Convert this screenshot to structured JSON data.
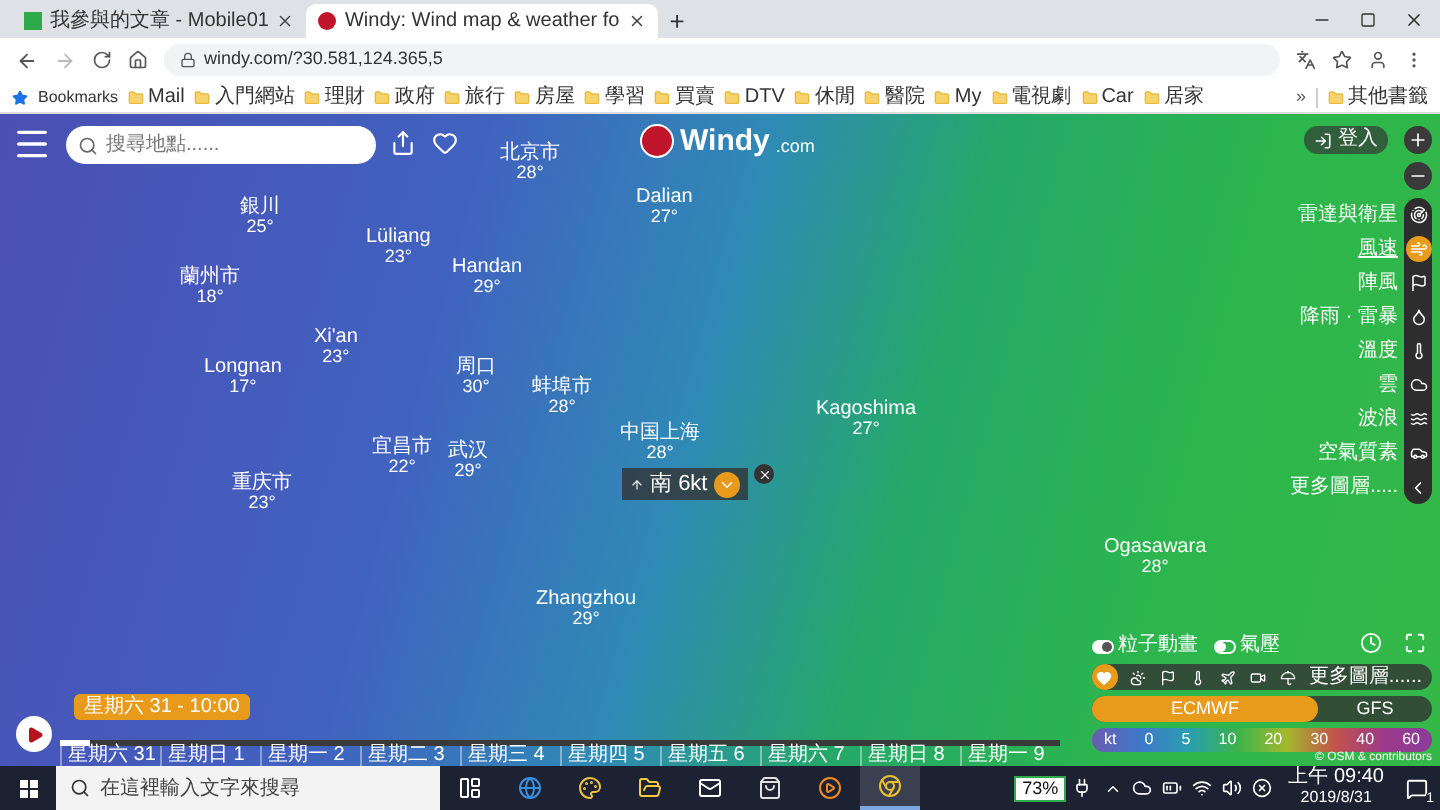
{
  "browser": {
    "tabs": [
      {
        "title": "我參與的文章 - Mobile01",
        "selected": false
      },
      {
        "title": "Windy: Wind map & weather fo",
        "selected": true
      }
    ],
    "new_tab": "+",
    "url": "windy.com/?30.581,124.365,5",
    "bookmarks_label": "Bookmarks",
    "bookmarks": [
      "Mail",
      "入門網站",
      "理財",
      "政府",
      "旅行",
      "房屋",
      "學習",
      "買賣",
      "DTV",
      "休閒",
      "醫院",
      "My",
      "電視劇",
      "Car",
      "居家"
    ],
    "more_bookmarks": "»",
    "other_bookmarks": "其他書籤"
  },
  "map": {
    "search": {
      "placeholder": "搜尋地點......"
    },
    "logo": {
      "name": "Windy",
      "suffix": ".com"
    },
    "login": "登入",
    "labels": [
      {
        "name": "北京市",
        "temp": "28°"
      },
      {
        "name": "銀川",
        "temp": "25°"
      },
      {
        "name": "Lüliang",
        "temp": "23°"
      },
      {
        "name": "Handan",
        "temp": "29°"
      },
      {
        "name": "Dalian",
        "temp": "27°"
      },
      {
        "name": "蘭州市",
        "temp": "18°"
      },
      {
        "name": "Xi'an",
        "temp": "23°"
      },
      {
        "name": "Longnan",
        "temp": "17°"
      },
      {
        "name": "周口",
        "temp": "30°"
      },
      {
        "name": "蚌埠市",
        "temp": "28°"
      },
      {
        "name": "宜昌市",
        "temp": "22°"
      },
      {
        "name": "武汉",
        "temp": "29°"
      },
      {
        "name": "重庆市",
        "temp": "23°"
      },
      {
        "name": "中国上海",
        "temp": "28°"
      },
      {
        "name": "Kagoshima",
        "temp": "27°"
      },
      {
        "name": "Zhangzhou",
        "temp": "29°"
      },
      {
        "name": "Ogasawara",
        "temp": "28°"
      }
    ],
    "popup": {
      "direction": "南",
      "speed": "6kt"
    }
  },
  "layers": [
    {
      "label": "雷達與衛星",
      "selected": false
    },
    {
      "label": "風速",
      "selected": true
    },
    {
      "label": "陣風",
      "selected": false
    },
    {
      "label": "降雨 · 雷暴",
      "selected": false
    },
    {
      "label": "溫度",
      "selected": false
    },
    {
      "label": "雲",
      "selected": false
    },
    {
      "label": "波浪",
      "selected": false
    },
    {
      "label": "空氣質素",
      "selected": false
    }
  ],
  "more_layers": "更多圖層.....",
  "toggles": [
    {
      "label": "粒子動畫",
      "on": true
    },
    {
      "label": "氣壓",
      "on": false
    }
  ],
  "favorites": [
    {
      "selected": true
    },
    {
      "selected": false
    },
    {
      "selected": false
    },
    {
      "selected": false
    },
    {
      "selected": false
    },
    {
      "selected": false
    },
    {
      "selected": false
    }
  ],
  "favorites_more": "更多圖層......",
  "models": [
    {
      "label": "ECMWF",
      "selected": true
    },
    {
      "label": "GFS",
      "selected": false
    }
  ],
  "legend": {
    "unit": "kt",
    "values": [
      "0",
      "5",
      "10",
      "20",
      "30",
      "40",
      "60"
    ]
  },
  "attribution": "© OSM & contributors",
  "timeline": {
    "current": "星期六 31 - 10:00",
    "level": 0.03,
    "days": [
      "星期六 31",
      "星期日 1",
      "星期一 2",
      "星期二 3",
      "星期三 4",
      "星期四 5",
      "星期五 6",
      "星期六 7",
      "星期日 8",
      "星期一 9"
    ]
  },
  "taskbar": {
    "search_placeholder": "在這裡輸入文字來搜尋",
    "apps": [
      {
        "active": false
      },
      {
        "active": false
      },
      {
        "active": false
      },
      {
        "active": false
      },
      {
        "active": false
      },
      {
        "active": false
      },
      {
        "active": false
      },
      {
        "active": true
      }
    ],
    "battery": "73%",
    "time": "上午 09:40",
    "date": "2019/8/31",
    "notifications": "1"
  }
}
